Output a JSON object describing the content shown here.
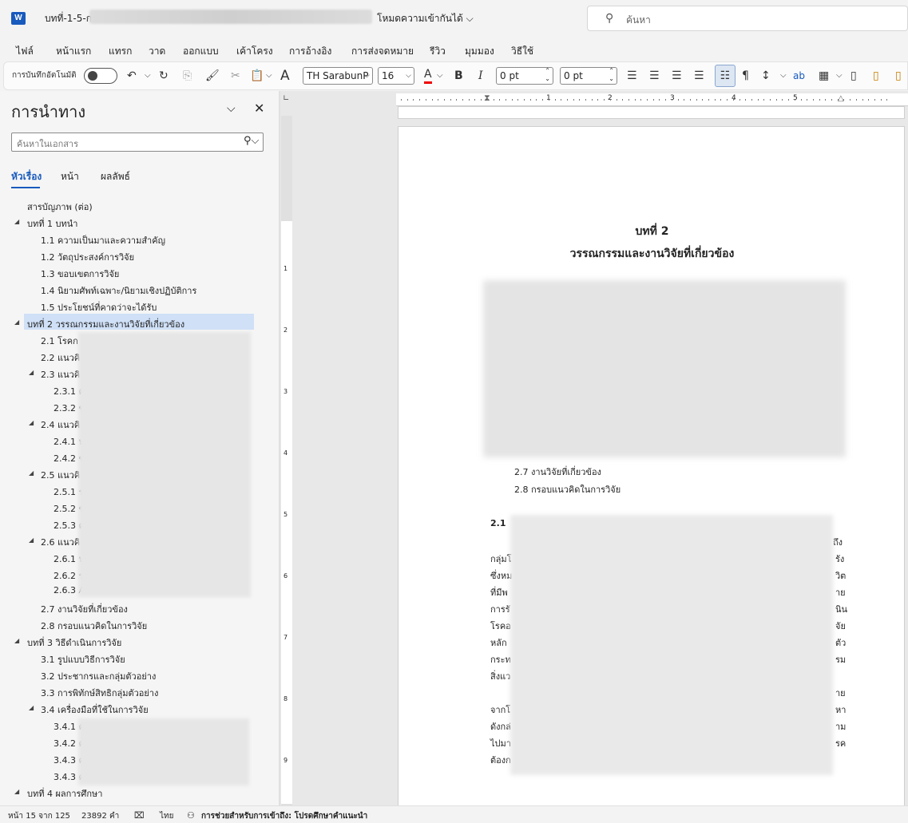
{
  "title_bar": {
    "app_icon": "word-logo",
    "doc_title": "บทที่-1-5-ก",
    "mode": "โหมดความเข้ากันได้ ⌵",
    "search_placeholder": "ค้นหา"
  },
  "menu": [
    "ไฟล์",
    "หน้าแรก",
    "แทรก",
    "วาด",
    "ออกแบบ",
    "เค้าโครง",
    "การอ้างอิง",
    "การส่งจดหมาย",
    "รีวิว",
    "มุมมอง",
    "วิธีใช้"
  ],
  "toolbar": {
    "autosave_label": "การบันทึกอัตโนมัติ",
    "font_name": "TH SarabunP",
    "font_size": "16",
    "spacing_before": "0 pt",
    "spacing_after": "0 pt"
  },
  "nav": {
    "title": "การนำทาง",
    "search_placeholder": "ค้นหาในเอกสาร",
    "tabs": [
      "หัวเรื่อง",
      "หน้า",
      "ผลลัพธ์"
    ],
    "items": [
      {
        "text": "สารบัญภาพ (ต่อ)"
      },
      {
        "text": "บทที่ 1  บทนำ"
      },
      {
        "text": "1.1 ความเป็นมาและความสำคัญ"
      },
      {
        "text": "1.2 วัตถุประสงค์การวิจัย"
      },
      {
        "text": "1.3 ขอบเขตการวิจัย"
      },
      {
        "text": "1.4 นิยามศัพท์เฉพาะ/นิยามเชิงปฏิบัติการ"
      },
      {
        "text": "1.5 ประโยชน์ที่คาดว่าจะได้รับ"
      },
      {
        "text": "บทที่ 2 วรรณกรรมและงานวิจัยที่เกี่ยวข้อง"
      },
      {
        "text": "2.1 โรคก"
      },
      {
        "text": "2.2 แนวคิ"
      },
      {
        "text": "2.3  แนวคิ"
      },
      {
        "text": "2.3.1 ค"
      },
      {
        "text": "2.3.2 ข"
      },
      {
        "text": "2.4 แนวคิ"
      },
      {
        "text": "2.4.1 น"
      },
      {
        "text": "2.4.2 ข"
      },
      {
        "text": "2.5 แนวคิ"
      },
      {
        "text": "2.5.1 ร"
      },
      {
        "text": "2.5.2 ข"
      },
      {
        "text": "2.5.3 ค"
      },
      {
        "text": "2.6 แนวคิ"
      },
      {
        "text": "2.6.1 น"
      },
      {
        "text": "2.6.2 ร"
      },
      {
        "text": "2.6.3 A"
      },
      {
        "text": "2.7 งานวิจัยที่เกี่ยวข้อง"
      },
      {
        "text": "2.8 กรอบแนวคิดในการวิจัย"
      },
      {
        "text": "บทที่ 3 วิธีดำเนินการวิจัย"
      },
      {
        "text": "3.1 รูปแบบวิธีการวิจัย"
      },
      {
        "text": "3.2 ประชากรและกลุ่มตัวอย่าง"
      },
      {
        "text": "3.3 การพิทักษ์สิทธิกลุ่มตัวอย่าง"
      },
      {
        "text": "3.4 เครื่องมือที่ใช้ในการวิจัย"
      },
      {
        "text": "3.4.1 ค"
      },
      {
        "text": "3.4.2 ค"
      },
      {
        "text": "3.4.3 ค"
      },
      {
        "text": "3.4.3 ค"
      },
      {
        "text": "บทที่ 4 ผลการศึกษา"
      }
    ]
  },
  "ruler_numbers": [
    "1",
    "2",
    "3",
    "4",
    "5"
  ],
  "ruler_left_numbers": [
    "1",
    "2",
    "3",
    "4",
    "5",
    "6",
    "7",
    "8",
    "9"
  ],
  "page": {
    "chapter": "บทที่ 2",
    "heading": "วรรณกรรมและงานวิจัยที่เกี่ยวข้อง",
    "list": [
      "2.7  งานวิจัยที่เกี่ยวข้อง",
      "2.8  กรอบแนวคิดในการวิจัย"
    ],
    "section_number": "2.1",
    "left_fragments": [
      "กลุ่มโ",
      "ซึ่งหม",
      "ที่มีพ",
      "การรั",
      "โรคอ",
      "หลัก",
      "กระท",
      "สิ่งแว",
      "จากโ",
      "ดังกล่",
      "ไปมา",
      "ต้องก"
    ],
    "right_fragments": [
      "ถึง",
      "รัง",
      "วิต",
      "าย",
      "นิน",
      "จัย",
      "ตัว",
      "รม",
      "าย",
      "หา",
      "าม",
      "รค"
    ]
  },
  "status": {
    "page": "หน้า 15 จาก 125",
    "words": "23892 คำ",
    "language": "ไทย",
    "accessibility": "การช่วยสำหรับการเข้าถึง: โปรดศึกษาคำแนะนำ"
  }
}
